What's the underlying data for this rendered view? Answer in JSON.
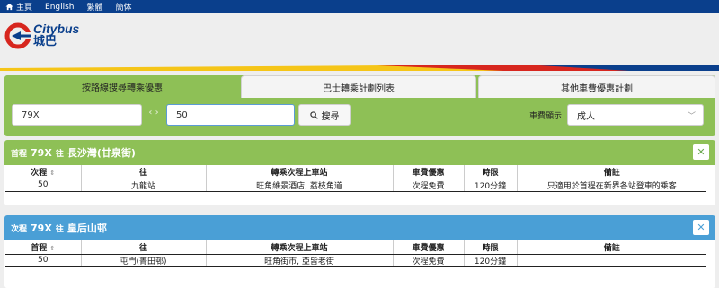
{
  "nav": {
    "home": "主頁",
    "english": "English",
    "trad": "繁體",
    "simp": "簡体"
  },
  "logo": {
    "en": "Citybus",
    "zh": "城巴"
  },
  "tabs": [
    {
      "label": "按路線搜尋轉乘優惠"
    },
    {
      "label": "巴士轉乘計劃列表"
    },
    {
      "label": "其他車費優惠計劃"
    }
  ],
  "search": {
    "route_value": "79X",
    "stop_value": "50",
    "swap_glyph": "‹ ›",
    "button_label": "搜尋",
    "fare_label": "車費顯示",
    "fare_value": "成人"
  },
  "results": [
    {
      "direction": "首程",
      "route": "79X",
      "to_word": "往",
      "destination": "長沙灣(甘泉街)",
      "columns": [
        "次程",
        "往",
        "轉乘次程上車站",
        "車費優惠",
        "時限",
        "備註"
      ],
      "rows": [
        [
          "50",
          "九龍站",
          "旺角維景酒店, 荔枝角道",
          "次程免費",
          "120分鐘",
          "只適用於首程在新界各站登車的乘客"
        ]
      ]
    },
    {
      "direction": "次程",
      "route": "79X",
      "to_word": "往",
      "destination": "皇后山邨",
      "columns": [
        "首程",
        "往",
        "轉乘次程上車站",
        "車費優惠",
        "時限",
        "備註"
      ],
      "rows": [
        [
          "50",
          "屯門(菁田邨)",
          "旺角街市, 亞皆老街",
          "次程免費",
          "120分鐘",
          ""
        ]
      ]
    }
  ],
  "colors": {
    "nav_bg": "#0a3f8c",
    "panel_green": "#8ec056",
    "first_header": "#8ec056",
    "second_header": "#4a9fd6",
    "brand_red": "#d7261e"
  }
}
